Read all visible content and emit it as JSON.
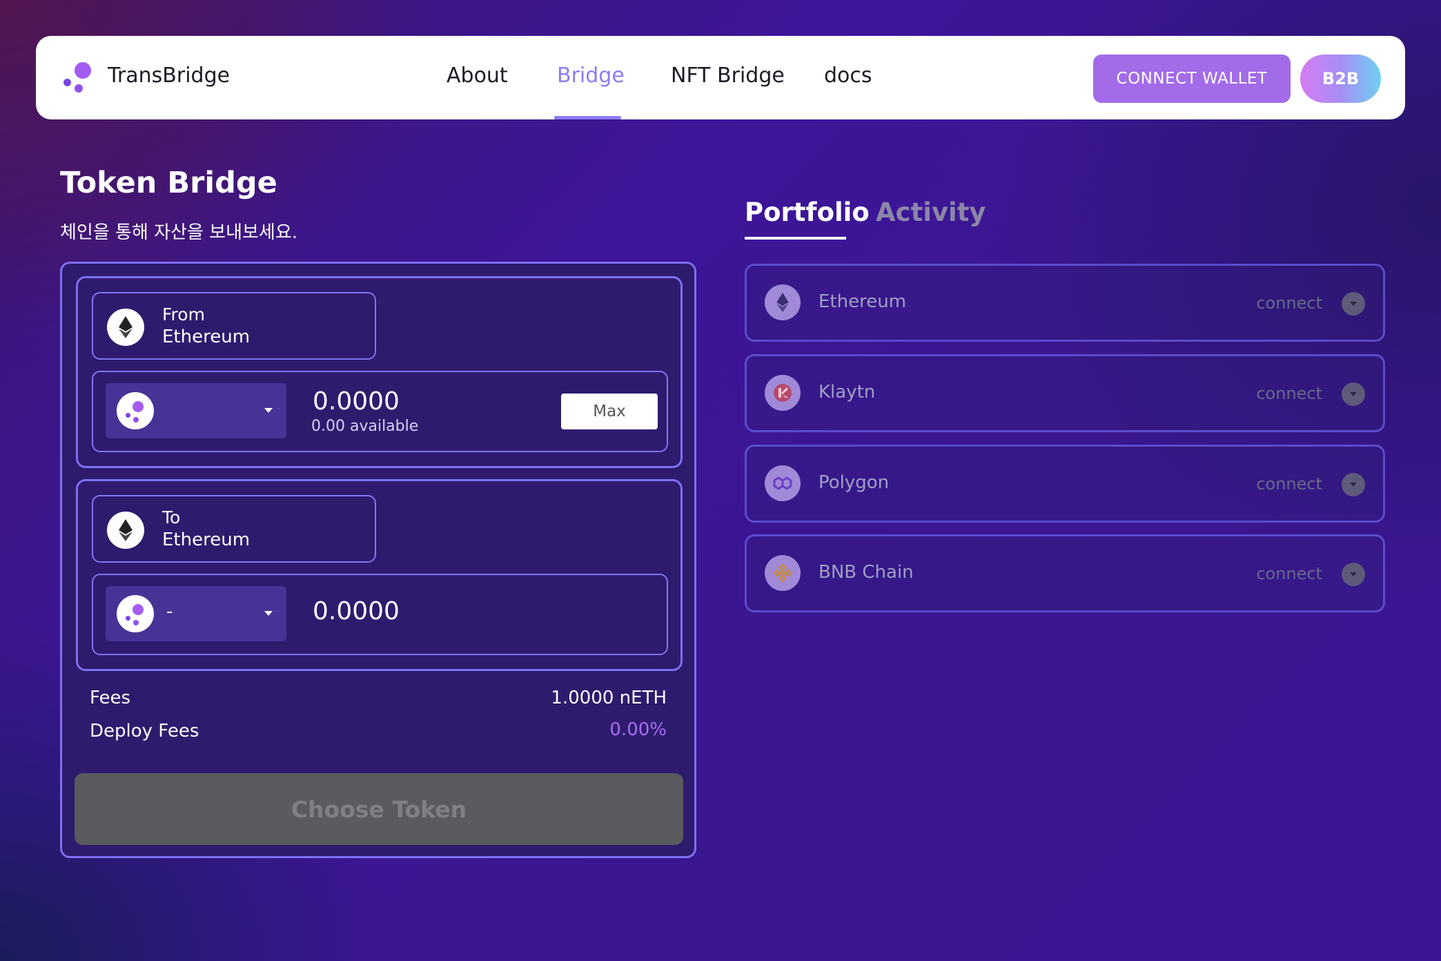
{
  "header": {
    "brand": "TransBridge",
    "nav": [
      "About",
      "Bridge",
      "NFT Bridge",
      "docs"
    ],
    "active_nav": "Bridge",
    "connect_wallet": "CONNECT WALLET",
    "b2b": "B2B"
  },
  "bridge": {
    "title": "Token Bridge",
    "subtitle": "체인을 통해 자산을 보내보세요.",
    "from": {
      "label": "From",
      "chain": "Ethereum",
      "chain_icon": "ethereum-icon",
      "token": "",
      "amount": "0.0000",
      "available": "0.00 available",
      "max_label": "Max"
    },
    "to": {
      "label": "To",
      "chain": "Ethereum",
      "chain_icon": "ethereum-icon",
      "token": "-",
      "amount": "0.0000"
    },
    "fees_label": "Fees",
    "fees_value": "1.0000 nETH",
    "deploy_fees_label": "Deploy Fees",
    "deploy_fees_value": "0.00%",
    "choose_token": "Choose Token"
  },
  "portfolio": {
    "tabs": [
      "Portfolio",
      "Activity"
    ],
    "active_tab": "Portfolio",
    "networks": [
      {
        "name": "Ethereum",
        "action": "connect",
        "icon": "ethereum-icon"
      },
      {
        "name": "Klaytn",
        "action": "connect",
        "icon": "klaytn-icon"
      },
      {
        "name": "Polygon",
        "action": "connect",
        "icon": "polygon-icon"
      },
      {
        "name": "BNB Chain",
        "action": "connect",
        "icon": "bnb-icon"
      }
    ]
  },
  "colors": {
    "accent": "#8b7cf4",
    "connect_button": "#a36be8",
    "deploy_fee": "#a86ef0",
    "disabled_button": "#5a5a5f"
  }
}
